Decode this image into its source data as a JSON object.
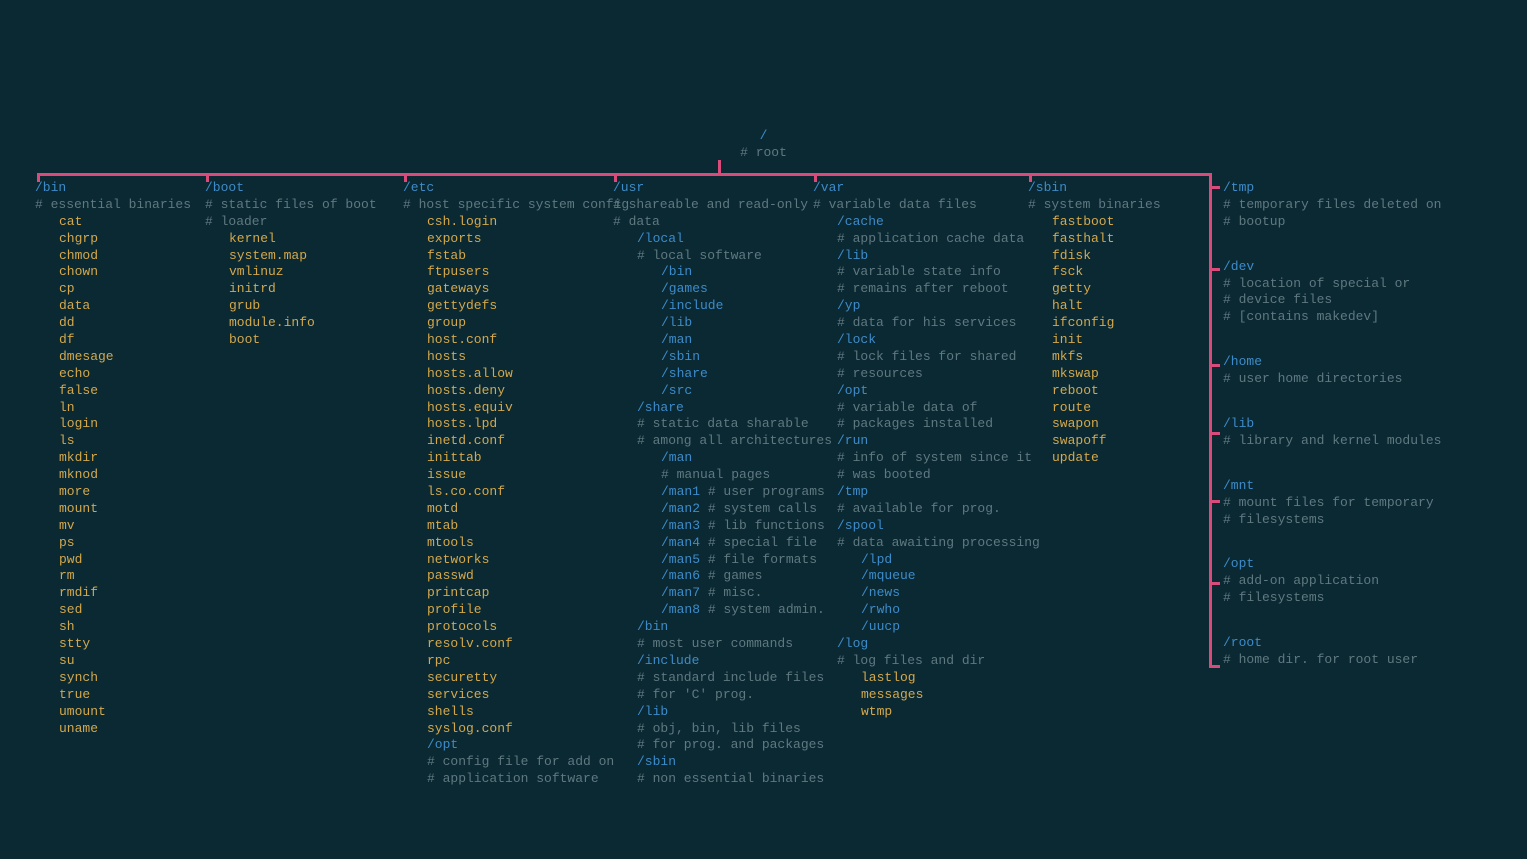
{
  "root": {
    "path": "/",
    "comment": "# root"
  },
  "bin": {
    "title": "/bin",
    "comment": "# essential binaries",
    "items": [
      "cat",
      "chgrp",
      "chmod",
      "chown",
      "cp",
      "data",
      "dd",
      "df",
      "dmesage",
      "echo",
      "false",
      "ln",
      "login",
      "ls",
      "mkdir",
      "mknod",
      "more",
      "mount",
      "mv",
      "ps",
      "pwd",
      "rm",
      "rmdif",
      "sed",
      "sh",
      "stty",
      "su",
      "synch",
      "true",
      "umount",
      "uname"
    ]
  },
  "boot": {
    "title": "/boot",
    "comment": "# static files of boot",
    "loader_c": "# loader",
    "items": [
      "kernel",
      "system.map",
      "vmlinuz",
      "initrd",
      "grub",
      "module.info",
      "boot"
    ]
  },
  "etc": {
    "title": "/etc",
    "comment": "# host specific system config",
    "items": [
      "csh.login",
      "exports",
      "fstab",
      "ftpusers",
      "gateways",
      "gettydefs",
      "group",
      "host.conf",
      "hosts",
      "hosts.allow",
      "hosts.deny",
      "hosts.equiv",
      "hosts.lpd",
      "inetd.conf",
      "inittab",
      "issue",
      "ls.co.conf",
      "motd",
      "mtab",
      "mtools",
      "networks",
      "passwd",
      "printcap",
      "profile",
      "protocols",
      "resolv.conf",
      "rpc",
      "securetty",
      "services",
      "shells",
      "syslog.conf"
    ],
    "opt": "/opt",
    "opt_c1": "# config file for add on",
    "opt_c2": "# application software"
  },
  "usr": {
    "title": "/usr",
    "comment": "# shareable and read-only",
    "data_c": "# data",
    "local": "/local",
    "local_c": "# local software",
    "local_items": [
      "/bin",
      "/games",
      "/include",
      "/lib",
      "/man",
      "/sbin",
      "/share",
      "/src"
    ],
    "share": "/share",
    "share_c1": "# static data sharable",
    "share_c2": "# among all architectures",
    "man": "/man",
    "man_c": "# manual pages",
    "man_items": [
      {
        "n": "/man1",
        "c": "# user programs"
      },
      {
        "n": "/man2",
        "c": "# system calls"
      },
      {
        "n": "/man3",
        "c": "# lib functions"
      },
      {
        "n": "/man4",
        "c": "# special file"
      },
      {
        "n": "/man5",
        "c": "# file formats"
      },
      {
        "n": "/man6",
        "c": "# games"
      },
      {
        "n": "/man7",
        "c": "# misc."
      },
      {
        "n": "/man8",
        "c": "# system admin."
      }
    ],
    "bin2": "/bin",
    "bin2_c": "# most user commands",
    "include": "/include",
    "include_c1": "# standard include files",
    "include_c2": "# for 'C' prog.",
    "lib": "/lib",
    "lib_c1": "# obj, bin, lib files",
    "lib_c2": "# for prog. and packages",
    "sbin": "/sbin",
    "sbin_c": "# non essential binaries"
  },
  "var": {
    "title": "/var",
    "comment": "# variable data files",
    "cache": "/cache",
    "cache_c": "# application cache data",
    "lib": "/lib",
    "lib_c1": "# variable state info",
    "lib_c2": "# remains after reboot",
    "yp": "/yp",
    "yp_c": "# data for his services",
    "lock": "/lock",
    "lock_c1": "# lock files for shared",
    "lock_c2": "# resources",
    "opt": "/opt",
    "opt_c1": "# variable data of",
    "opt_c2": "# packages installed",
    "run": "/run",
    "run_c1": "# info of system since it",
    "run_c2": "# was booted",
    "tmp": "/tmp",
    "tmp_c": "# available for prog.",
    "spool": "/spool",
    "spool_c": "# data awaiting processing",
    "spool_items": [
      "/lpd",
      "/mqueue",
      "/news",
      "/rwho",
      "/uucp"
    ],
    "log": "/log",
    "log_c": "# log files and dir",
    "log_items": [
      "lastlog",
      "messages",
      "wtmp"
    ]
  },
  "sbin": {
    "title": "/sbin",
    "comment": "# system binaries",
    "items": [
      "fastboot",
      "fasthalt",
      "fdisk",
      "fsck",
      "getty",
      "halt",
      "ifconfig",
      "init",
      "mkfs",
      "mkswap",
      "reboot",
      "route",
      "swapon",
      "swapoff",
      "update"
    ]
  },
  "right": {
    "tmp": "/tmp",
    "tmp_c1": "# temporary files deleted on",
    "tmp_c2": "# bootup",
    "dev": "/dev",
    "dev_c1": "# location of special or",
    "dev_c2": "# device files",
    "dev_c3": "# [contains makedev]",
    "home": "/home",
    "home_c": "# user home directories",
    "lib": "/lib",
    "lib_c": "# library and kernel modules",
    "mnt": "/mnt",
    "mnt_c1": "# mount files for temporary",
    "mnt_c2": "# filesystems",
    "opt": "/opt",
    "opt_c1": "# add-on application",
    "opt_c2": "# filesystems",
    "root": "/root",
    "root_c": "# home dir. for root user"
  }
}
